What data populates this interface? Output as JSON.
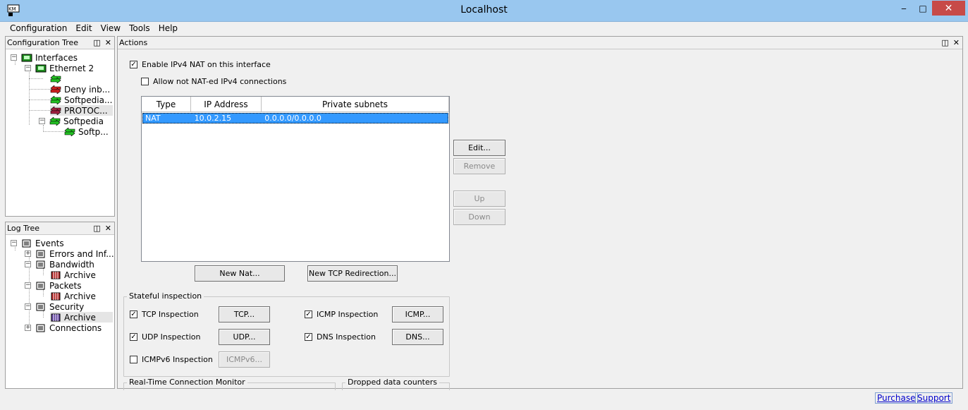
{
  "window": {
    "title": "Localhost",
    "min": "‒",
    "max": "□",
    "close": "✕"
  },
  "menu": [
    "Configuration",
    "Edit",
    "View",
    "Tools",
    "Help"
  ],
  "config_tree": {
    "title": "Configuration Tree",
    "pin": "⮺",
    "close": "✕",
    "items": [
      {
        "label": "Interfaces"
      },
      {
        "label": "Ethernet 2"
      },
      {
        "label": ""
      },
      {
        "label": "Deny inb..."
      },
      {
        "label": "Softpedia..."
      },
      {
        "label": "PROTOC..."
      },
      {
        "label": "Softpedia"
      },
      {
        "label": "Softp..."
      }
    ]
  },
  "log_tree": {
    "title": "Log Tree",
    "items": [
      {
        "label": "Events"
      },
      {
        "label": "Errors and Inf..."
      },
      {
        "label": "Bandwidth"
      },
      {
        "label": "Archive"
      },
      {
        "label": "Packets"
      },
      {
        "label": "Archive"
      },
      {
        "label": "Security"
      },
      {
        "label": "Archive"
      },
      {
        "label": "Connections"
      }
    ]
  },
  "actions": {
    "title": "Actions",
    "enable_nat": "Enable IPv4 NAT on this interface",
    "allow_not_nated": "Allow not NAT-ed IPv4 connections",
    "columns": [
      "Type",
      "IP Address",
      "Private subnets"
    ],
    "rows": [
      {
        "type": "NAT",
        "ip": "10.0.2.15",
        "subnets": "0.0.0.0/0.0.0.0"
      }
    ],
    "buttons": {
      "edit": "Edit...",
      "remove": "Remove",
      "up": "Up",
      "down": "Down",
      "new_nat": "New Nat...",
      "new_tcp": "New TCP Redirection..."
    },
    "stateful": {
      "title": "Stateful inspection",
      "tcp": "TCP Inspection",
      "tcp_btn": "TCP...",
      "icmp": "ICMP Inspection",
      "icmp_btn": "ICMP...",
      "udp": "UDP Inspection",
      "udp_btn": "UDP...",
      "dns": "DNS Inspection",
      "dns_btn": "DNS...",
      "icmpv6": "ICMPv6 Inspection",
      "icmpv6_btn": "ICMPv6..."
    },
    "rtcm_title": "Real-Time Connection Monitor",
    "dropped_title": "Dropped data counters"
  },
  "status": {
    "purchase": "Purchase",
    "support": "Support"
  },
  "colors": {
    "titlebar": "#99c7ef",
    "close": "#c74a48",
    "selection": "#3399ff"
  }
}
